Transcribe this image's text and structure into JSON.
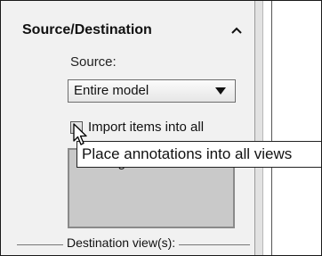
{
  "section": {
    "title": "Source/Destination",
    "collapse_icon": "chevron-up-icon"
  },
  "source": {
    "label": "Source:",
    "selected": "Entire model"
  },
  "import_option": {
    "label": "Import items into all views",
    "checked": false
  },
  "tooltip": {
    "text": "Place annotations into all views"
  },
  "views_list": {
    "items": [
      "Drawing View1"
    ]
  },
  "destination": {
    "label": "Destination view(s):"
  },
  "colors": {
    "panel_bg": "#f1f1f1",
    "listbox_bg": "#c9c9c9",
    "tooltip_bg": "#ffffff"
  }
}
